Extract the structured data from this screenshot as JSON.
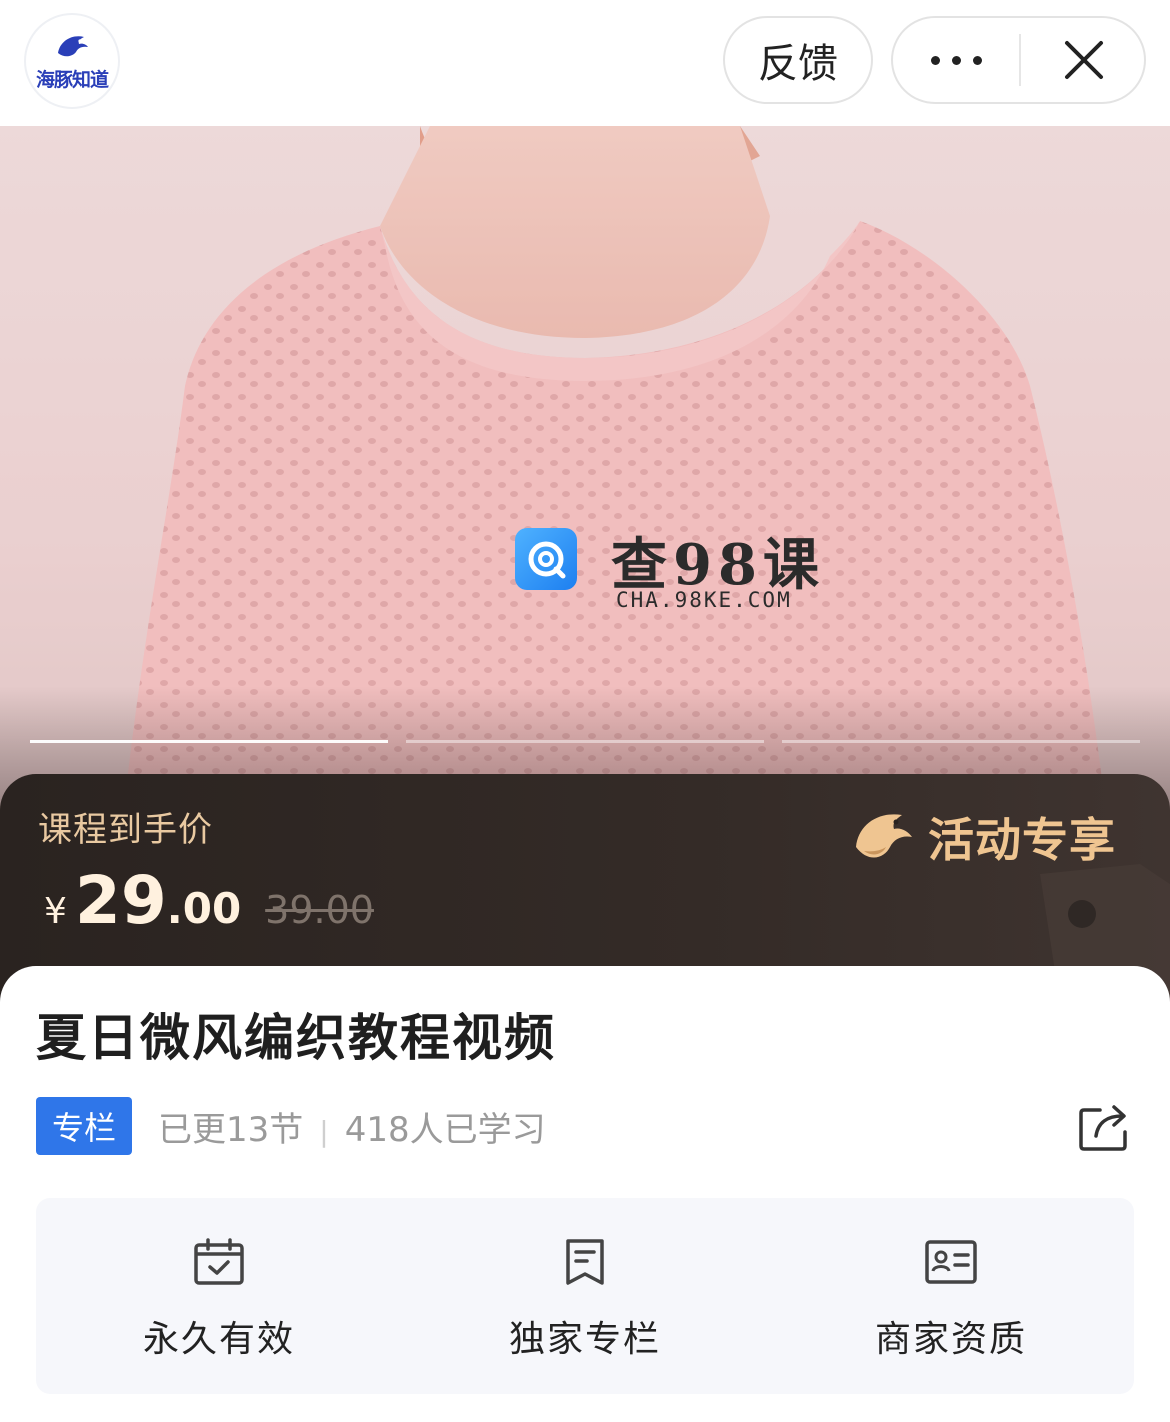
{
  "topbar": {
    "logo_text": "海豚知道",
    "feedback_label": "反馈",
    "more_icon": "more-dots-icon",
    "close_icon": "close-icon"
  },
  "hero": {
    "watermark_title": "查98课",
    "watermark_url": "CHA.98KE.COM",
    "carousel_count": 3,
    "carousel_active": 1
  },
  "price": {
    "label": "课程到手价",
    "currency": "¥",
    "integer": "29",
    "decimal": ".00",
    "original": "39.00",
    "promo_label": "活动专享"
  },
  "course": {
    "title": "夏日微风编织教程视频",
    "tag": "专栏",
    "lessons": "已更13节",
    "learners": "418人已学习",
    "share_icon": "share-icon"
  },
  "features": [
    {
      "label": "永久有效",
      "icon": "calendar-check-icon"
    },
    {
      "label": "独家专栏",
      "icon": "bookmark-doc-icon"
    },
    {
      "label": "商家资质",
      "icon": "id-card-icon"
    }
  ],
  "colors": {
    "accent_blue": "#2f76e9",
    "gold": "#efc591",
    "banner_dark": "#2a2320"
  }
}
